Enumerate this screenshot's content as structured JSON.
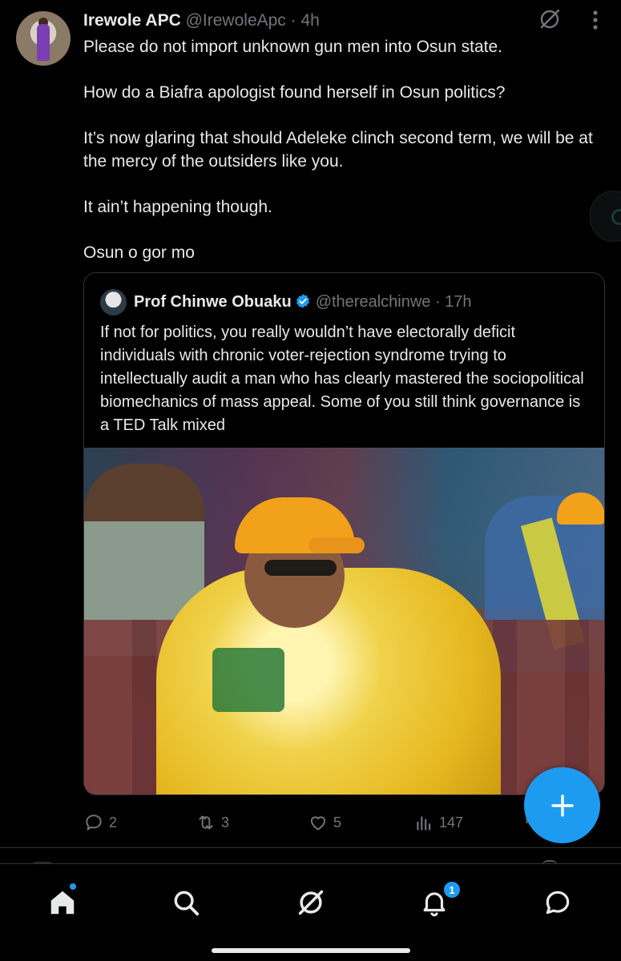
{
  "tweet": {
    "author_name": "Irewole APC",
    "author_handle": "@IrewoleApc",
    "separator": " · ",
    "time": "4h",
    "paragraphs": [
      "Please do not import unknown gun men into Osun state.",
      "How do a Biafra apologist found herself in Osun politics?",
      "It’s now glaring that should Adeleke clinch second term, we will be at the mercy of the outsiders like you.",
      "It ain’t happening though.",
      "Osun o gor mo"
    ],
    "header_icons": [
      "grok-icon",
      "more-icon"
    ]
  },
  "quote": {
    "author_name": "Prof Chinwe Obuaku",
    "author_handle": "@therealchinwe",
    "separator": " · ",
    "time": "17h",
    "verified": true,
    "text": "If not for politics, you really wouldn’t have electorally deficit individuals with chronic voter-rejection syndrome trying to intellectually audit a man who has clearly mastered the sociopolitical biomechanics of mass appeal. Some of you still think governance is a TED Talk mixed",
    "image_icon": "photo-man-in-yellow-shirt-and-orange-cap"
  },
  "actions": {
    "replies": "2",
    "reposts": "3",
    "likes": "5",
    "views": "147"
  },
  "nav": {
    "items": [
      "home-icon",
      "search-icon",
      "grok-icon",
      "notifications-icon",
      "messages-icon"
    ],
    "notification_count": "1"
  },
  "colors": {
    "background": "#000000",
    "text": "#e7e9ea",
    "secondary": "#71767b",
    "accent": "#1d9bf0",
    "border": "#2f3336"
  }
}
